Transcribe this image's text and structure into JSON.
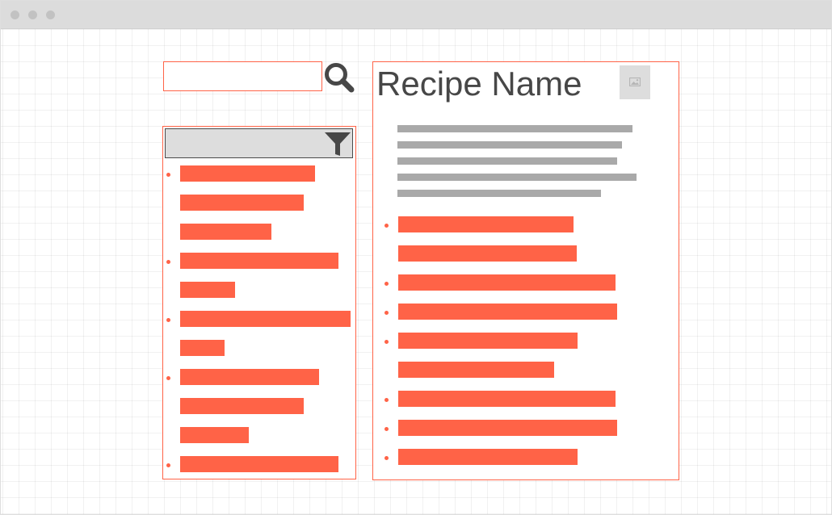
{
  "window": {
    "title": ""
  },
  "search": {
    "value": "",
    "placeholder": "",
    "icon": "search-icon"
  },
  "filter": {
    "icon": "filter-icon"
  },
  "recipe": {
    "title": "Recipe Name",
    "image_icon": "image-icon"
  },
  "colors": {
    "accent": "#ff6347",
    "placeholder_gray": "#a9a9a9",
    "panel_gray": "#dddddd",
    "text": "#474747",
    "titlebar": "#dcdcdc"
  }
}
